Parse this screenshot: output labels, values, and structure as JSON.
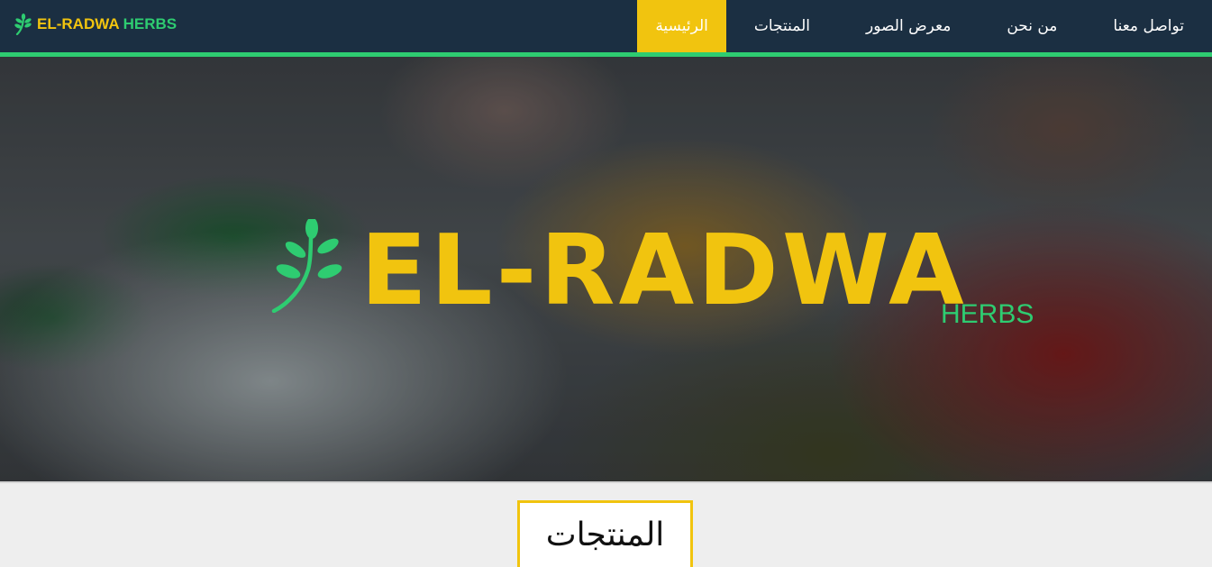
{
  "brand": {
    "name_primary": "EL-RADWA",
    "name_secondary": "HERBS",
    "icon": "leaf-sprig-icon"
  },
  "nav": {
    "items": [
      {
        "label": "تواصل معنا",
        "active": false
      },
      {
        "label": "من نحن",
        "active": false
      },
      {
        "label": "معرض الصور",
        "active": false
      },
      {
        "label": "المنتجات",
        "active": false
      },
      {
        "label": "الرئيسية",
        "active": true
      }
    ]
  },
  "hero": {
    "title": "EL-RADWA",
    "subtitle": "HERBS",
    "icon": "leaf-sprig-icon"
  },
  "section": {
    "heading": "المنتجات"
  },
  "colors": {
    "navbar_bg": "#1b2f42",
    "accent_green": "#2ecc71",
    "accent_yellow": "#f1c40f",
    "page_bg": "#eeeeee"
  }
}
